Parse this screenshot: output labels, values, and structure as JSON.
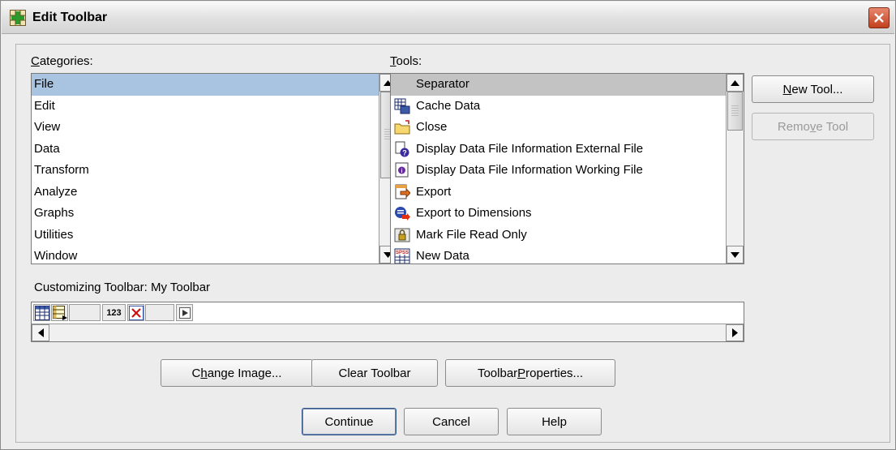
{
  "window": {
    "title": "Edit Toolbar"
  },
  "categories": {
    "label_prefix": "",
    "label_mnemonic": "C",
    "label_rest": "ategories:",
    "items": [
      "File",
      "Edit",
      "View",
      "Data",
      "Transform",
      "Analyze",
      "Graphs",
      "Utilities",
      "Window"
    ],
    "selected": "File"
  },
  "tools": {
    "label_mnemonic": "T",
    "label_rest": "ools:",
    "items": [
      {
        "label": "Separator",
        "icon": "separator-icon"
      },
      {
        "label": "Cache Data",
        "icon": "cache-data-icon"
      },
      {
        "label": "Close",
        "icon": "folder-close-icon"
      },
      {
        "label": "Display Data File Information External File",
        "icon": "file-info-external-icon"
      },
      {
        "label": "Display Data File Information Working File",
        "icon": "file-info-working-icon"
      },
      {
        "label": "Export",
        "icon": "export-icon"
      },
      {
        "label": "Export to Dimensions",
        "icon": "export-dimensions-icon"
      },
      {
        "label": "Mark File Read Only",
        "icon": "lock-file-icon"
      },
      {
        "label": "New Data",
        "icon": "new-data-icon"
      }
    ],
    "selected": "Separator"
  },
  "side_buttons": {
    "new_tool_mnemonic": "N",
    "new_tool_rest": "ew Tool...",
    "remove_tool_pre": "Remo",
    "remove_tool_mnemonic": "v",
    "remove_tool_rest": "e Tool"
  },
  "customizing": {
    "label": "Customizing Toolbar:  My Toolbar",
    "toolbar_items": [
      "data-editor-icon",
      "variable-view-icon",
      "blank-slot",
      "123-icon",
      "delete-x-icon",
      "blank-slot",
      "play-icon"
    ],
    "num_label": "123"
  },
  "action_buttons": {
    "change_image_pre": "C",
    "change_image_mnemonic": "h",
    "change_image_rest": "ange Image...",
    "clear_toolbar": "Clear Toolbar",
    "toolbar_props_pre": "Toolbar ",
    "toolbar_props_mnemonic": "P",
    "toolbar_props_rest": "roperties..."
  },
  "footer_buttons": {
    "continue": "Continue",
    "cancel": "Cancel",
    "help": "Help"
  },
  "colors": {
    "selection_blue": "#a8c4e0",
    "selection_gray": "#c3c3c3",
    "close_red": "#c2401d"
  }
}
